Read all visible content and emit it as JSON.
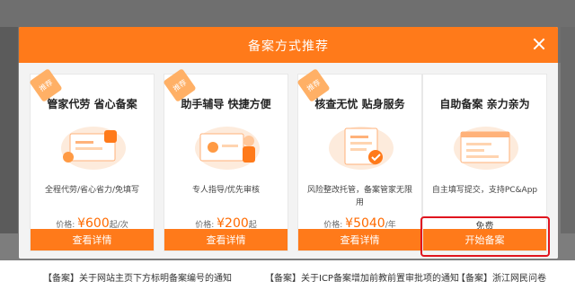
{
  "modal": {
    "title": "备案方式推荐",
    "cards": [
      {
        "ribbon": "推荐",
        "title": "管家代劳 省心备案",
        "desc": "全程代劳/省心省力/免填写",
        "price_label": "价格: ",
        "price_value": "¥600",
        "price_unit": "起/次",
        "button": "查看详情"
      },
      {
        "ribbon": "推荐",
        "title": "助手辅导 快捷方便",
        "desc": "专人指导/优先审核",
        "price_label": "价格: ",
        "price_value": "¥200",
        "price_unit": "起",
        "button": "查看详情"
      },
      {
        "ribbon": "推荐",
        "title": "核查无忧 贴身服务",
        "desc": "风险整改托管，备案管家无限用",
        "price_label": "价格: ",
        "price_value": "¥5040",
        "price_unit": "/年",
        "button": "查看详情"
      },
      {
        "title": "自助备案 亲力亲为",
        "desc": "自主填写提交，支持PC&App",
        "free": "免费",
        "button": "开始备案"
      }
    ]
  },
  "background": {
    "news": [
      "【备案】关于网站主页下方标明备案编号的通知",
      "【备案】关于ICP备案增加前教前置审批项的通知",
      "【备案】浙江网民问卷"
    ]
  },
  "colors": {
    "accent": "#ff7a1a",
    "price": "#ff6a00",
    "highlight": "#e0141e"
  }
}
